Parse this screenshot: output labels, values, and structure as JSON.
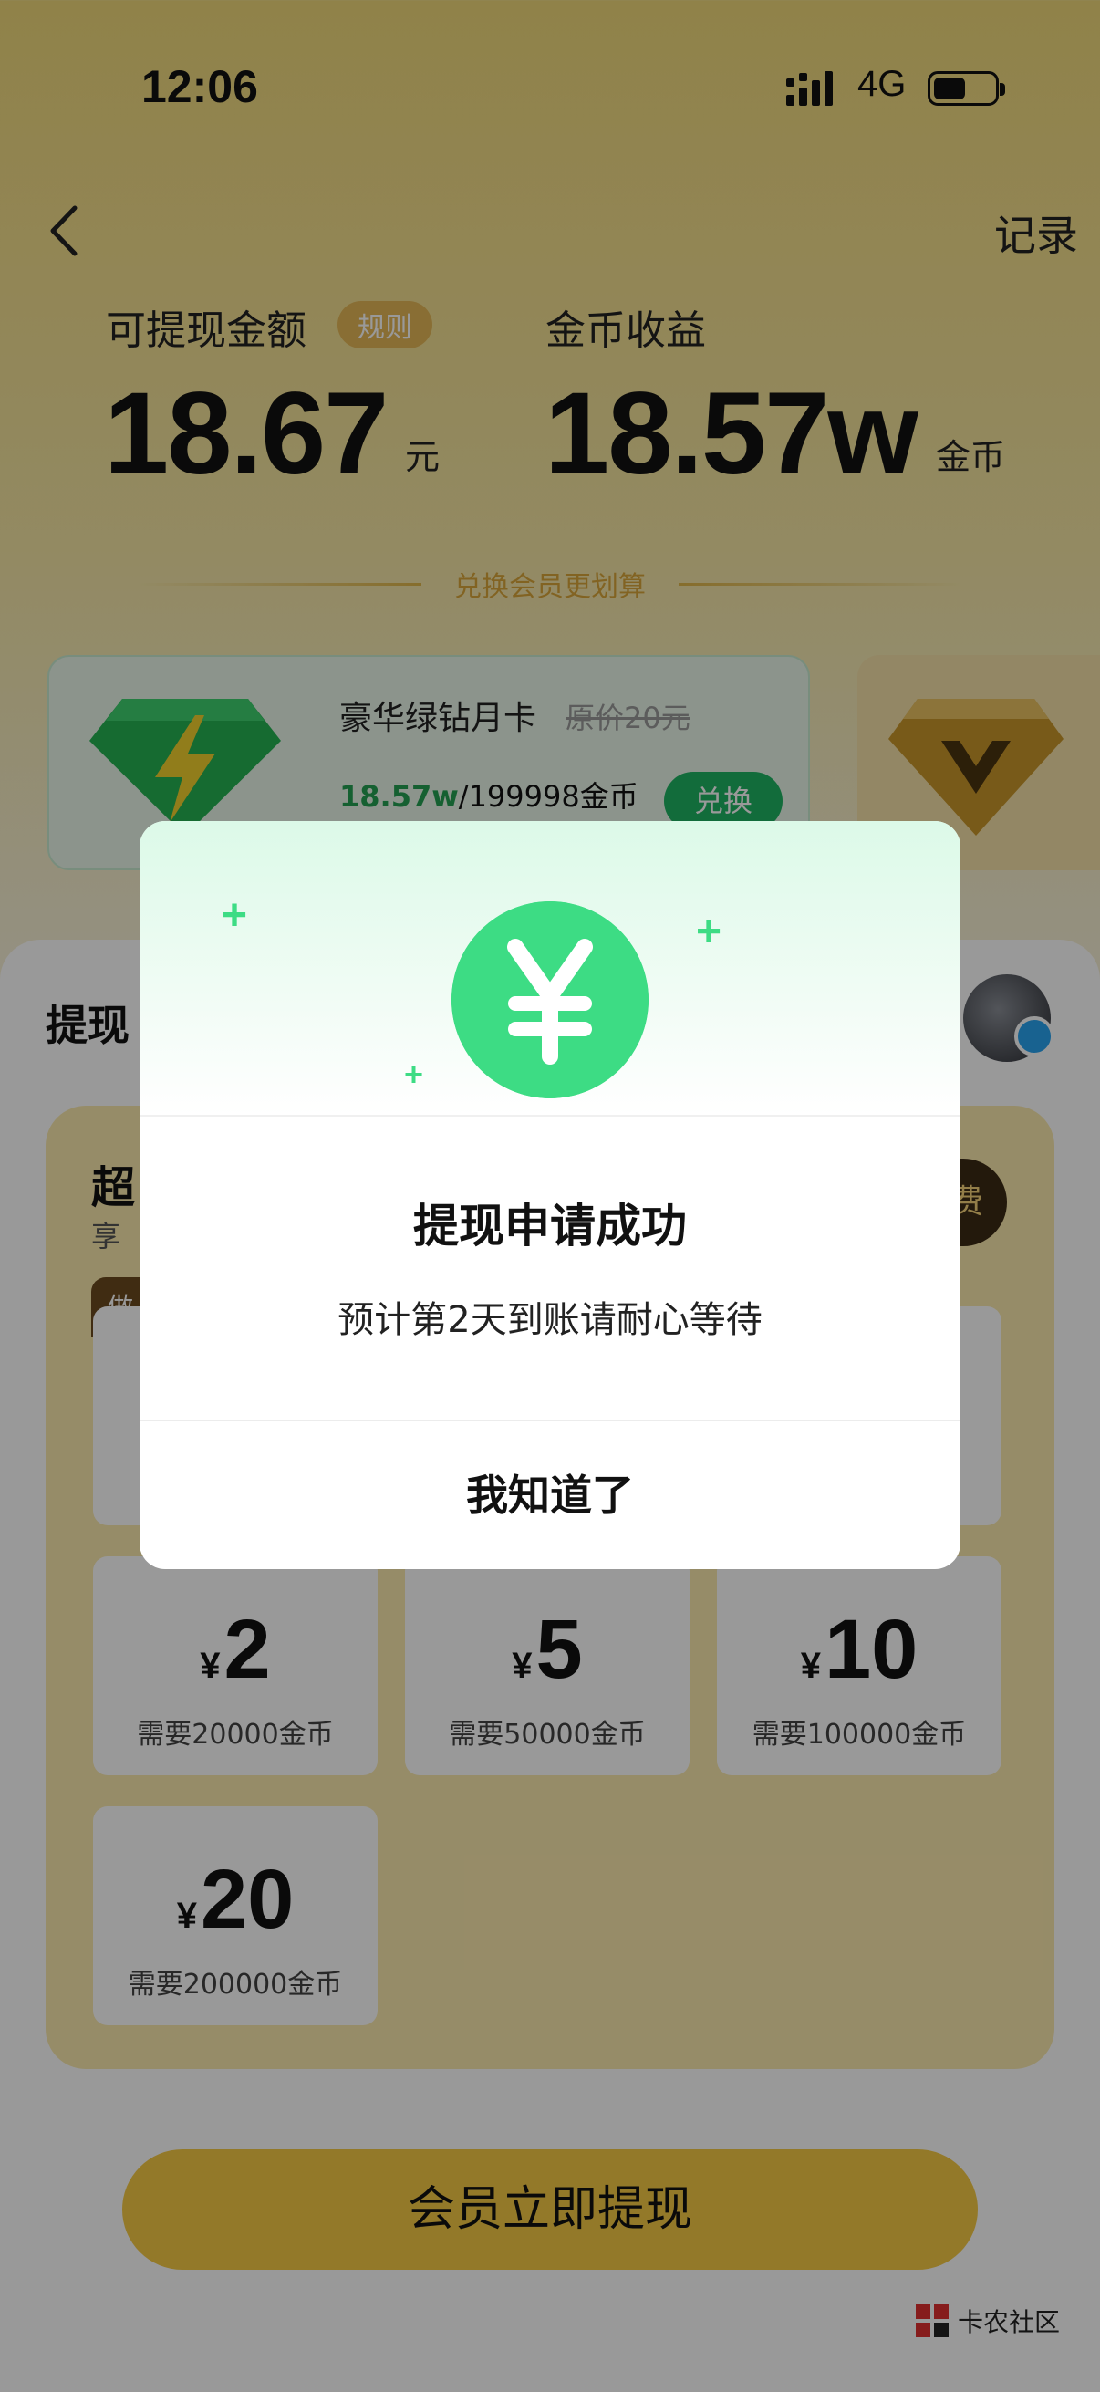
{
  "status_bar": {
    "time": "12:06",
    "network": "4G"
  },
  "header": {
    "records_label": "记录"
  },
  "balance": {
    "withdrawable_label": "可提现金额",
    "rule_badge": "规则",
    "withdrawable_amount": "18.67",
    "withdrawable_unit": "元",
    "coins_label": "金币收益",
    "coins_amount": "18.57w",
    "coins_unit": "金币"
  },
  "exchange": {
    "divider_text": "兑换会员更划算",
    "card": {
      "title": "豪华绿钻月卡",
      "original_price": "原价20元",
      "progress_current": "18.57w",
      "progress_target": "/199998金币",
      "button": "兑换"
    }
  },
  "withdraw_section": {
    "title_partial": "提现",
    "box_title_partial": "超",
    "box_sub_partial": "享",
    "tag_partial": "做",
    "badge_partial": "费",
    "options": [
      {
        "yen": "¥",
        "value": "2",
        "need": "需要20000金币"
      },
      {
        "yen": "¥",
        "value": "5",
        "need": "需要50000金币"
      },
      {
        "yen": "¥",
        "value": "10",
        "need": "需要100000金币"
      },
      {
        "yen": "¥",
        "value": "20",
        "need": "需要200000金币"
      }
    ],
    "cta": "会员立即提现"
  },
  "watermark": "卡农社区",
  "modal": {
    "coin_symbol": "¥",
    "title": "提现申请成功",
    "message": "预计第2天到账请耐心等待",
    "confirm": "我知道了"
  },
  "colors": {
    "accent_green": "#3ddc84",
    "accent_gold": "#f5ca45",
    "overlay": "rgba(0,0,0,0.40)"
  }
}
